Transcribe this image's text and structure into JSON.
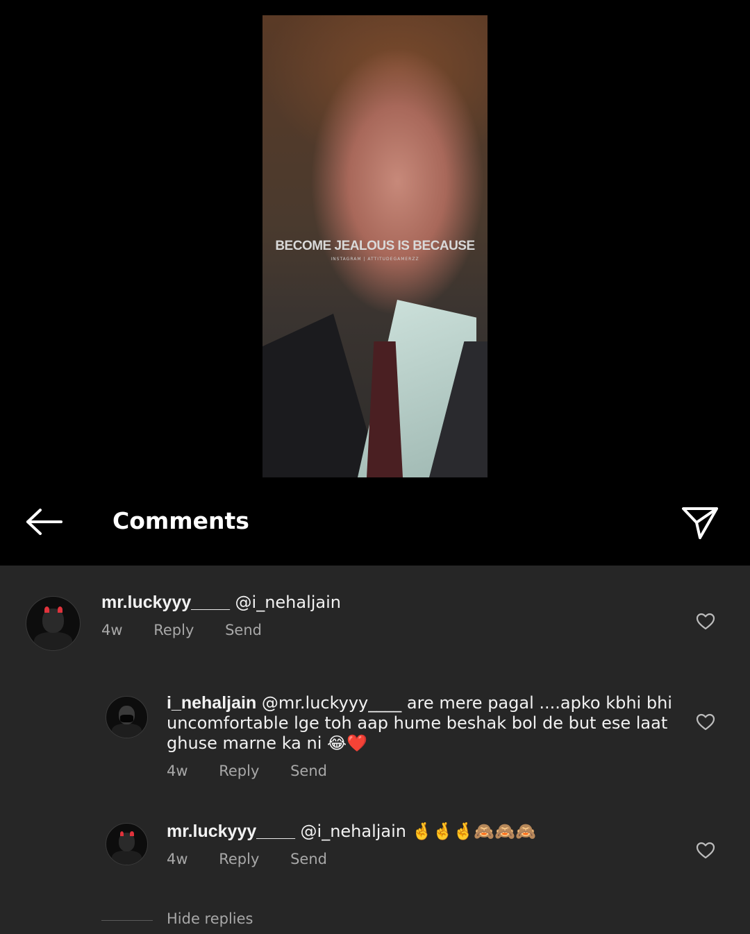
{
  "video": {
    "caption": "BECOME JEALOUS IS BECAUSE",
    "subcaption": "INSTAGRAM | ATTITUDEGAMERZZ"
  },
  "header": {
    "title": "Comments",
    "back_icon": "arrow-left-icon",
    "share_icon": "paper-plane-icon"
  },
  "comments": [
    {
      "username": "mr.luckyyy____",
      "text": " @i_nehaljain",
      "time": "4w",
      "reply_label": "Reply",
      "send_label": "Send"
    },
    {
      "username": "i_nehaljain",
      "text": " @mr.luckyyy____ are mere pagal ....apko kbhi bhi uncomfortable lge toh aap hume beshak bol de but ese laat ghuse marne ka ni 😂❤️",
      "time": "4w",
      "reply_label": "Reply",
      "send_label": "Send"
    },
    {
      "username": "mr.luckyyy____",
      "text": " @i_nehaljain 🤞🤞🤞🙈🙈🙈",
      "time": "4w",
      "reply_label": "Reply",
      "send_label": "Send"
    }
  ],
  "hide_replies_label": "Hide replies"
}
